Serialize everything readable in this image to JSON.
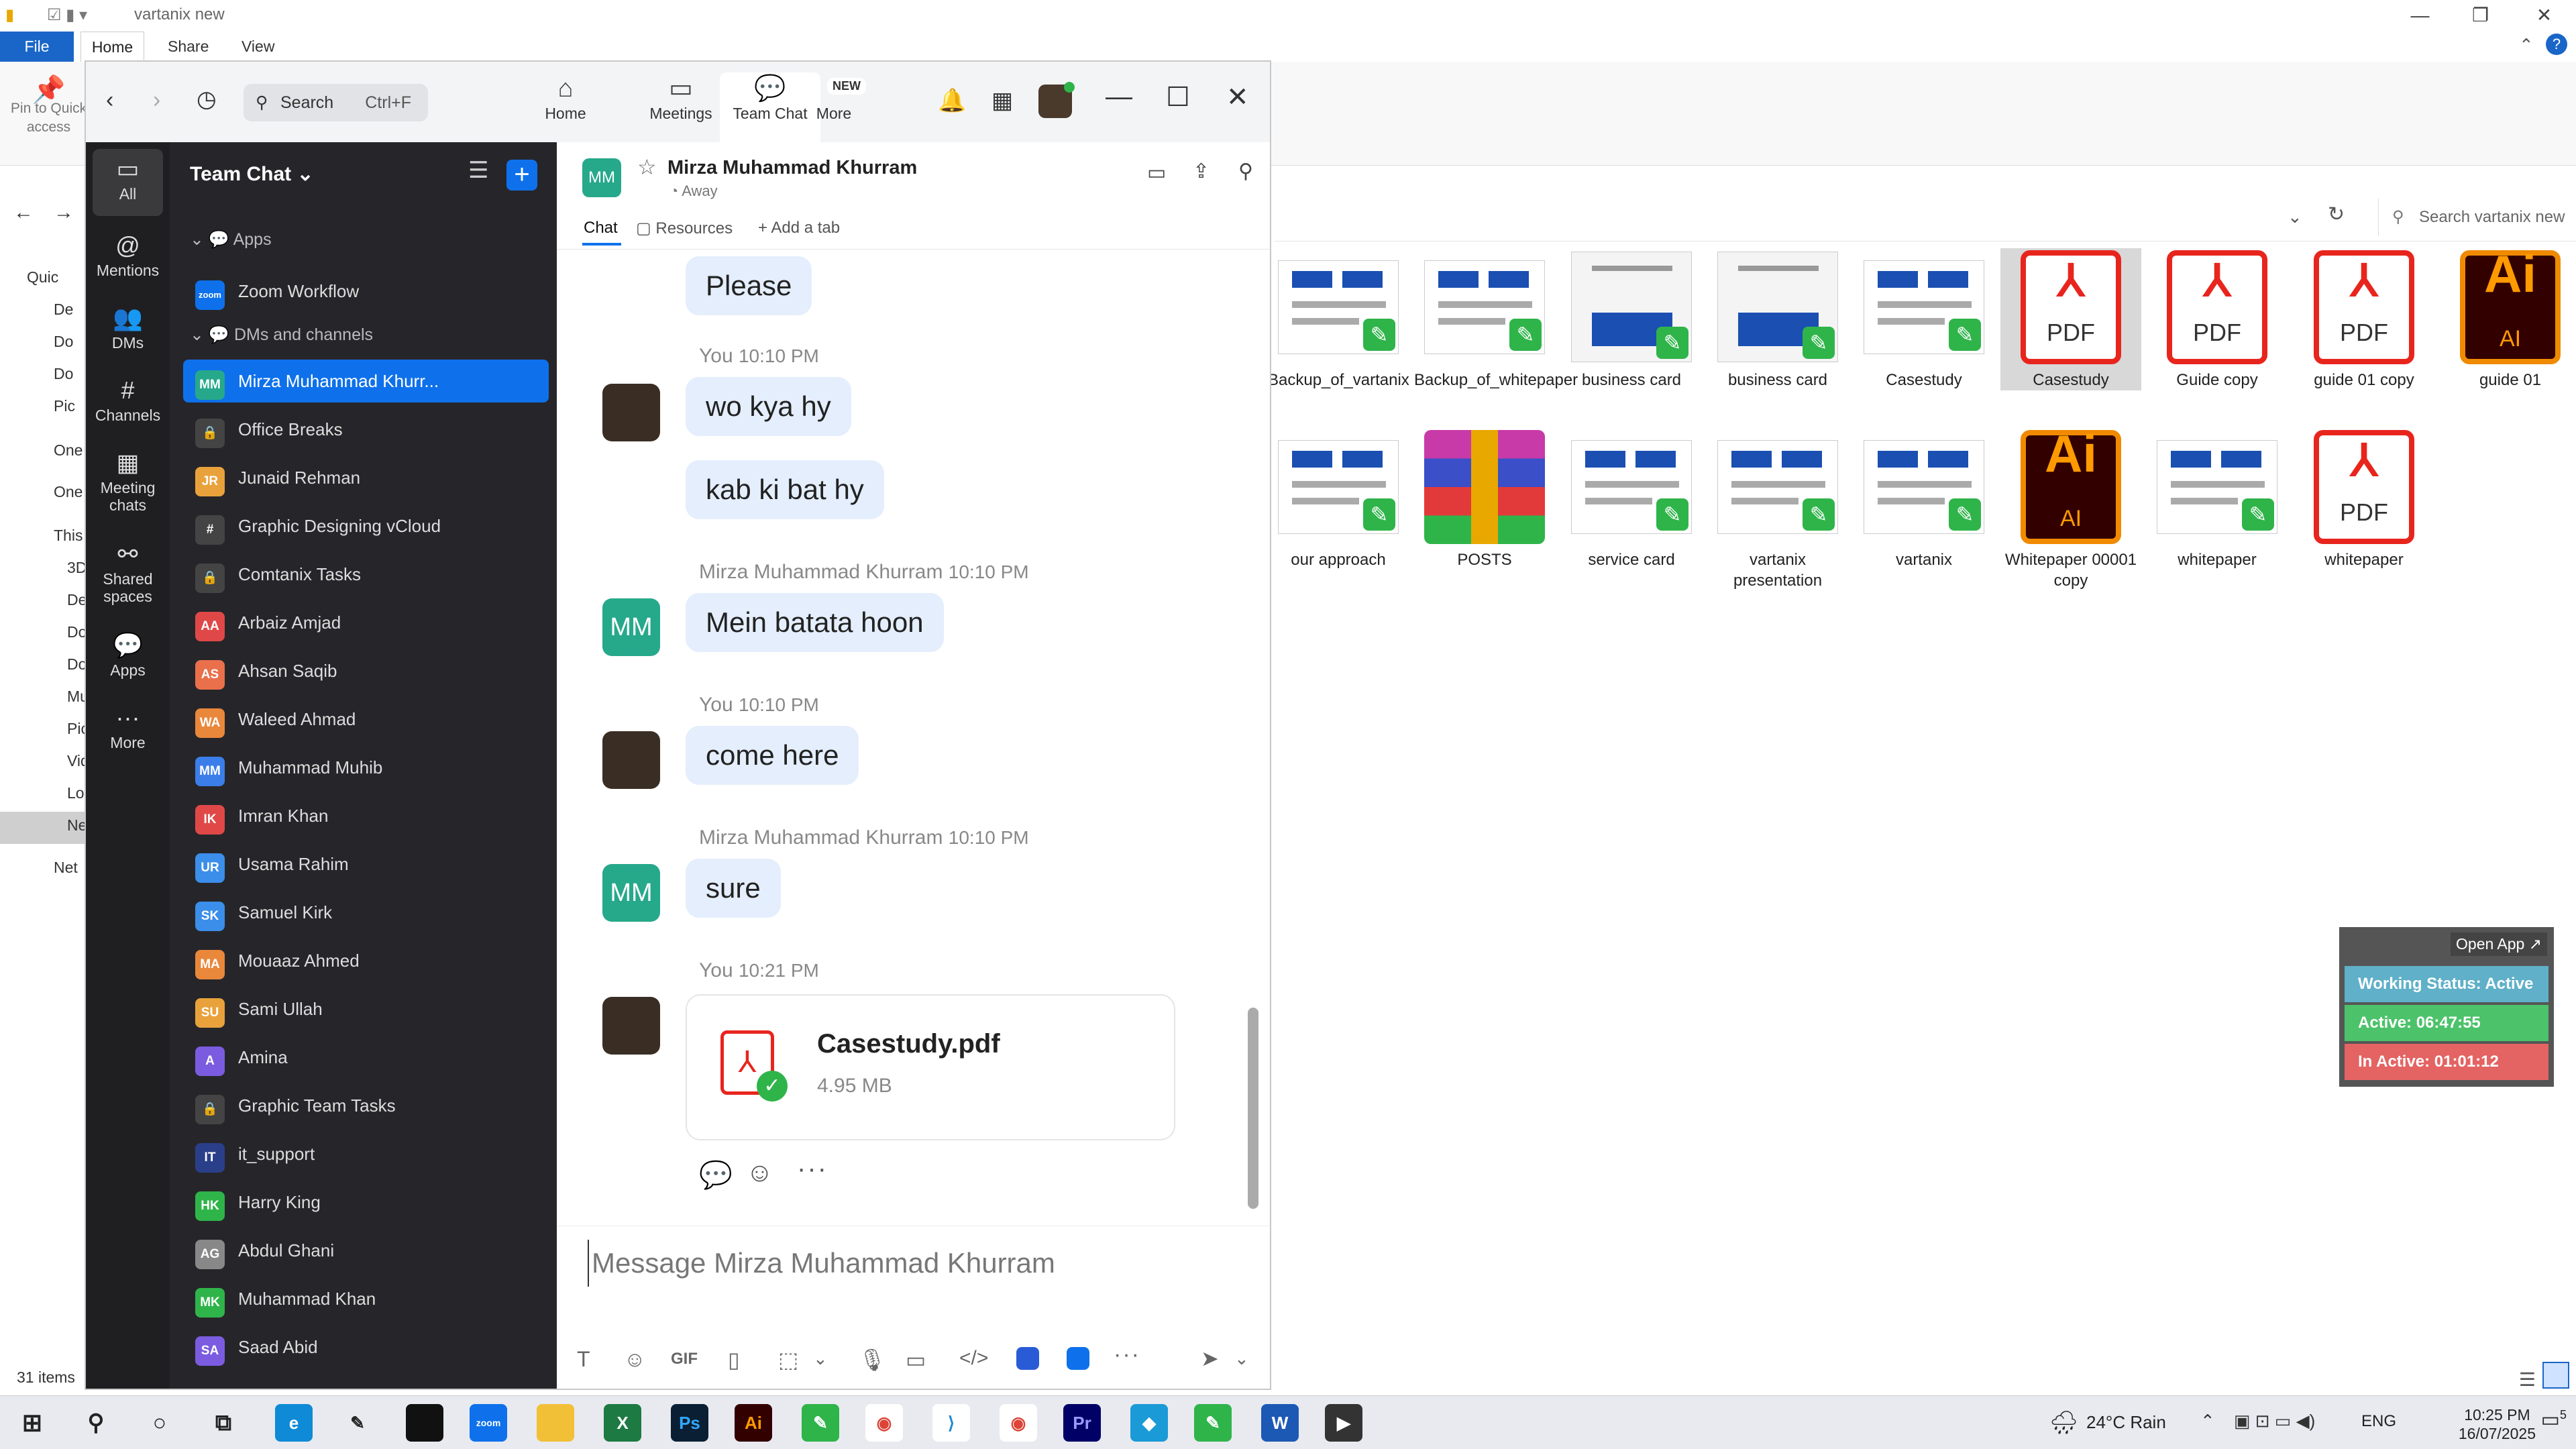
{
  "explorer": {
    "title": "vartanix new",
    "ribbon_tabs": {
      "file": "File",
      "home": "Home",
      "share": "Share",
      "view": "View"
    },
    "pin_label": "Pin to Quick access",
    "search_placeholder": "Search vartanix new",
    "nav_items": [
      "Quic",
      "De",
      "Do",
      "Do",
      "Pic",
      "One",
      "One",
      "This",
      "3D",
      "De",
      "Do",
      "Do",
      "Mu",
      "Pic",
      "Vid",
      "Lo",
      "Ne",
      "Net"
    ],
    "status": "31 items",
    "files": [
      {
        "name": "Backup_of_vartanix",
        "type": "thumb"
      },
      {
        "name": "Backup_of_whitepaper",
        "type": "thumb"
      },
      {
        "name": "business card",
        "type": "card"
      },
      {
        "name": "business card",
        "type": "card"
      },
      {
        "name": "Casestudy",
        "type": "thumb"
      },
      {
        "name": "Casestudy",
        "type": "pdf"
      },
      {
        "name": "Guide  copy",
        "type": "pdf"
      },
      {
        "name": "guide 01 copy",
        "type": "pdf"
      },
      {
        "name": "guide 01",
        "type": "ai"
      },
      {
        "name": "our approach",
        "type": "thumb"
      },
      {
        "name": "POSTS",
        "type": "rar"
      },
      {
        "name": "service card",
        "type": "thumb"
      },
      {
        "name": "vartanix presentation",
        "type": "thumb"
      },
      {
        "name": "vartanix",
        "type": "thumb"
      },
      {
        "name": "Whitepaper 00001 copy",
        "type": "ai"
      },
      {
        "name": "whitepaper",
        "type": "thumb"
      },
      {
        "name": "whitepaper",
        "type": "pdf"
      }
    ],
    "pdf_label": "PDF",
    "ai_label": "AI",
    "ai_big": "Ai"
  },
  "tracker": {
    "open_app": "Open App ↗",
    "working_status": "Working Status: Active",
    "active": "Active: 06:47:55",
    "inactive": "In Active: 01:01:12",
    "colors": {
      "status": "#5fb0c8",
      "active": "#4cc26a",
      "inactive": "#e46363"
    }
  },
  "zoom": {
    "search_placeholder": "Search",
    "search_shortcut": "Ctrl+F",
    "tabs": {
      "home": "Home",
      "meetings": "Meetings",
      "team_chat": "Team Chat",
      "more": "More"
    },
    "new_badge": "NEW",
    "rail": {
      "all": "All",
      "mentions": "Mentions",
      "dms": "DMs",
      "channels": "Channels",
      "meeting_chats": "Meeting chats",
      "shared_spaces": "Shared spaces",
      "apps": "Apps",
      "more": "More"
    },
    "list_title": "Team Chat",
    "section_apps": "Apps",
    "zoom_workflow": "Zoom Workflow",
    "section_dms": "DMs and channels",
    "chats": [
      {
        "name": "Mirza Muhammad Khurr...",
        "initials": "MM",
        "color": "#26a88b",
        "active": true
      },
      {
        "name": "Office Breaks",
        "initials": "🔒",
        "color": "#444"
      },
      {
        "name": "Junaid Rehman",
        "initials": "JR",
        "color": "#e9a23b"
      },
      {
        "name": "Graphic Designing vCloud",
        "initials": "#",
        "color": "#444"
      },
      {
        "name": "Comtanix Tasks",
        "initials": "🔒",
        "color": "#444"
      },
      {
        "name": "Arbaiz Amjad",
        "initials": "AA",
        "color": "#e04848"
      },
      {
        "name": "Ahsan Saqib",
        "initials": "AS",
        "color": "#e9704b"
      },
      {
        "name": "Waleed Ahmad",
        "initials": "WA",
        "color": "#e9873b"
      },
      {
        "name": "Muhammad Muhib",
        "initials": "MM",
        "color": "#3b7ee9"
      },
      {
        "name": "Imran Khan",
        "initials": "IK",
        "color": "#e04848"
      },
      {
        "name": "Usama Rahim",
        "initials": "UR",
        "color": "#3b8ee9"
      },
      {
        "name": "Samuel Kirk",
        "initials": "SK",
        "color": "#3b8ee9"
      },
      {
        "name": "Mouaaz Ahmed",
        "initials": "MA",
        "color": "#e9873b"
      },
      {
        "name": "Sami Ullah",
        "initials": "SU",
        "color": "#e9a23b"
      },
      {
        "name": "Amina",
        "initials": "A",
        "color": "#7b5ce0"
      },
      {
        "name": "Graphic Team Tasks",
        "initials": "🔒",
        "color": "#444"
      },
      {
        "name": "it_support",
        "initials": "IT",
        "color": "#2a3f8a"
      },
      {
        "name": "Harry King",
        "initials": "HK",
        "color": "#2fb44a"
      },
      {
        "name": "Abdul Ghani",
        "initials": "AG",
        "color": "#888"
      },
      {
        "name": "Muhammad Khan",
        "initials": "MK",
        "color": "#2fb44a"
      },
      {
        "name": "Saad Abid",
        "initials": "SA",
        "color": "#7b5ce0"
      }
    ],
    "chat": {
      "name": "Mirza Muhammad Khurram",
      "initials": "MM",
      "status": "Away",
      "tab_chat": "Chat",
      "tab_resources": "Resources",
      "tab_add": "Add a tab",
      "msg_please": "Please",
      "you_label": "You",
      "mirza_label": "Mirza Muhammad Khurram",
      "t1010": "10:10 PM",
      "t1021": "10:21 PM",
      "msg_wo": "wo kya hy",
      "msg_kab": "kab ki bat hy",
      "msg_mein": "Mein batata hoon",
      "msg_come": "come here",
      "msg_sure": "sure",
      "file_name": "Casestudy.pdf",
      "file_size": "4.95 MB",
      "compose_placeholder": "Message Mirza Muhammad Khurram",
      "gif": "GIF"
    }
  },
  "taskbar": {
    "weather": "24°C Rain",
    "lang": "ENG",
    "time": "10:25 PM",
    "date": "16/07/2025",
    "notif_count": "5"
  }
}
